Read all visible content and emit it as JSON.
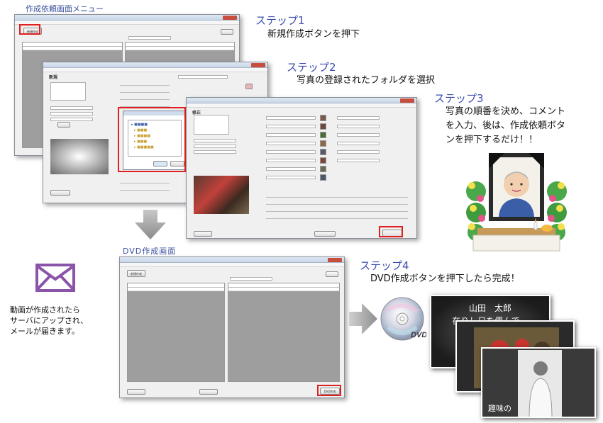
{
  "labels": {
    "menu_screen": "作成依頼画面メニュー",
    "dvd_screen": "DVD作成画面"
  },
  "steps": [
    {
      "title": "ステップ1",
      "desc": [
        "新規作成ボタンを押下"
      ]
    },
    {
      "title": "ステップ2",
      "desc": [
        "写真の登録されたフォルダを選択"
      ]
    },
    {
      "title": "ステップ3",
      "desc": [
        "写真の順番を決め、コメント",
        "を入力、後は、作成依頼ボタ",
        "ンを押下するだけ！！"
      ]
    },
    {
      "title": "ステップ4",
      "desc": [
        "DVD作成ボタンを押下したら完成！"
      ]
    }
  ],
  "mail_note": [
    "動画が作成されたら",
    "サーバにアップされ、",
    "メールが届きます。"
  ],
  "windows": {
    "menu": {
      "new_button": "新規作成"
    },
    "new": {
      "title": "新規"
    },
    "edit": {
      "title": "修正"
    },
    "dvd": {
      "new_button": "新規作成",
      "dvd_button": "DVD作成"
    }
  },
  "slides": {
    "slide1_line1": "山田　太郎",
    "slide1_line2": "在りし日を偲んで…",
    "slide3_text": "趣味の"
  },
  "colors": {
    "step_title": "#3b4db0",
    "highlight": "#e02020",
    "envelope": "#8a55a8",
    "arrow": "#9a9a9a"
  },
  "icons": [
    "envelope-icon",
    "arrow-down-icon",
    "arrow-right-icon",
    "dvd-disc-icon",
    "memorial-portrait-icon"
  ]
}
